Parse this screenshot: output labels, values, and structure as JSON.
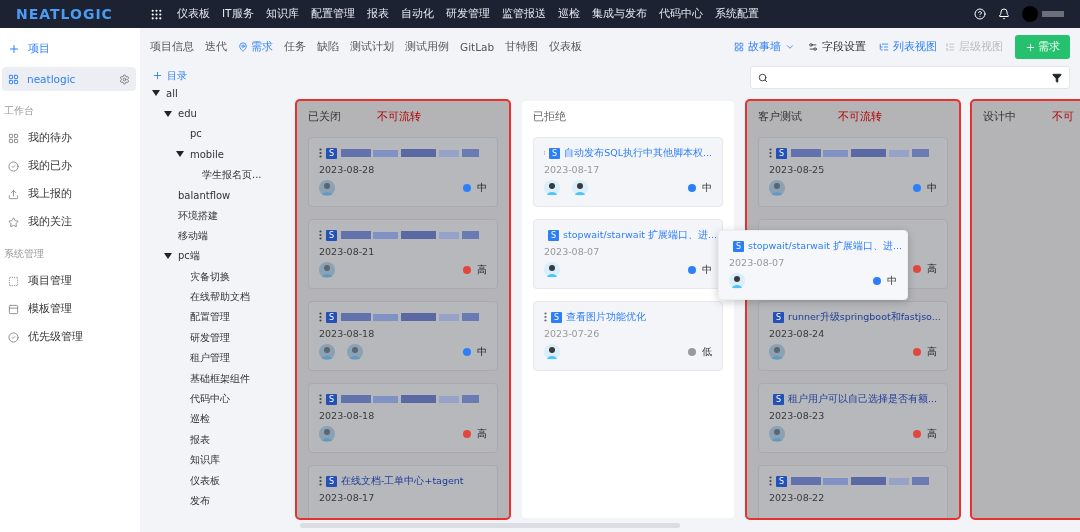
{
  "topbar": {
    "logo": "NEATLOGIC",
    "menu": [
      "仪表板",
      "IT服务",
      "知识库",
      "配置管理",
      "报表",
      "自动化",
      "研发管理",
      "监管报送",
      "巡检",
      "集成与发布",
      "代码中心",
      "系统配置"
    ]
  },
  "sidebar": {
    "add_label": "项目",
    "project": {
      "label": "neatlogic",
      "selected": true
    },
    "groups": [
      {
        "title": "工作台",
        "items": [
          {
            "label": "我的待办"
          },
          {
            "label": "我的已办"
          },
          {
            "label": "我上报的"
          },
          {
            "label": "我的关注"
          }
        ]
      },
      {
        "title": "系统管理",
        "items": [
          {
            "label": "项目管理"
          },
          {
            "label": "模板管理"
          },
          {
            "label": "优先级管理"
          }
        ]
      }
    ]
  },
  "tabs": [
    {
      "label": "项目信息",
      "selected": false
    },
    {
      "label": "迭代",
      "selected": false
    },
    {
      "label": "需求",
      "selected": true
    },
    {
      "label": "任务",
      "selected": false
    },
    {
      "label": "缺陷",
      "selected": false
    },
    {
      "label": "测试计划",
      "selected": false
    },
    {
      "label": "测试用例",
      "selected": false
    },
    {
      "label": "GitLab",
      "selected": false
    },
    {
      "label": "甘特图",
      "selected": false
    },
    {
      "label": "仪表板",
      "selected": false
    }
  ],
  "toolbar": {
    "view_menu": "故事墙",
    "field_settings": "字段设置",
    "list_view": {
      "label": "列表视图",
      "disabled": false
    },
    "tree_view": {
      "label": "层级视图",
      "disabled": true
    },
    "add_button": "需求"
  },
  "tree": {
    "add_label": "目录",
    "nodes": [
      {
        "label": "all",
        "expanded": true,
        "children": [
          {
            "label": "edu",
            "expanded": true,
            "children": [
              {
                "label": "pc"
              },
              {
                "label": "mobile",
                "expanded": true,
                "children": [
                  {
                    "label": "学生报名页..."
                  }
                ]
              }
            ]
          },
          {
            "label": "balantflow"
          },
          {
            "label": "环境搭建"
          },
          {
            "label": "移动端"
          },
          {
            "label": "pc端",
            "expanded": true,
            "children": [
              {
                "label": "灾备切换"
              },
              {
                "label": "在线帮助文档"
              },
              {
                "label": "配置管理"
              },
              {
                "label": "研发管理"
              },
              {
                "label": "租户管理"
              },
              {
                "label": "基础框架组件"
              },
              {
                "label": "代码中心"
              },
              {
                "label": "巡检"
              },
              {
                "label": "报表"
              },
              {
                "label": "知识库"
              },
              {
                "label": "仪表板"
              },
              {
                "label": "发布"
              }
            ]
          }
        ]
      }
    ]
  },
  "columns": [
    {
      "title": "已关闭",
      "disabled": true,
      "note": "不可流转",
      "cards": [
        {
          "type_badge": "S",
          "kind": "blurred",
          "date": "2023-08-28",
          "assignees": [
            {
              "kind": "avatar"
            }
          ],
          "priority": {
            "label": "中",
            "color": "#2d7ff9"
          }
        },
        {
          "type_badge": "S",
          "kind": "blurred",
          "date": "2023-08-21",
          "assignees": [
            {
              "kind": "avatar"
            }
          ],
          "priority": {
            "label": "高",
            "color": "#e0483e"
          }
        },
        {
          "type_badge": "S",
          "kind": "blurred",
          "date": "2023-08-18",
          "assignees": [
            {
              "kind": "avatar"
            },
            {
              "kind": "avatar"
            }
          ],
          "priority": {
            "label": "中",
            "color": "#2d7ff9"
          }
        },
        {
          "type_badge": "S",
          "kind": "blurred",
          "date": "2023-08-18",
          "assignees": [
            {
              "kind": "avatar"
            }
          ],
          "priority": {
            "label": "高",
            "color": "#e0483e"
          }
        },
        {
          "type_badge": "S",
          "kind": "titled",
          "title": "在线文档-工单中心+tagent",
          "date": "2023-08-17"
        }
      ]
    },
    {
      "title": "已拒绝",
      "disabled": false,
      "cards": [
        {
          "type_badge": "S",
          "kind": "titled",
          "title": "自动发布SQL执行中其他脚本权...",
          "date": "2023-08-17",
          "assignees": [
            {
              "kind": "avatar"
            },
            {
              "kind": "avatar"
            }
          ],
          "priority": {
            "label": "中",
            "color": "#2d7ff9"
          }
        },
        {
          "type_badge": "S",
          "kind": "titled",
          "title": "stopwait/starwait 扩展端口、进...",
          "date": "2023-08-07",
          "assignees": [
            {
              "kind": "avatar"
            }
          ],
          "priority": {
            "label": "中",
            "color": "#2d7ff9"
          }
        },
        {
          "type_badge": "S",
          "kind": "titled",
          "title": "查看图片功能优化",
          "date": "2023-07-26",
          "assignees": [
            {
              "kind": "avatar"
            }
          ],
          "priority": {
            "label": "低",
            "color": "#9a9a9a"
          }
        }
      ]
    },
    {
      "title": "客户测试",
      "disabled": true,
      "note": "不可流转",
      "cards": [
        {
          "type_badge": "S",
          "kind": "blurred",
          "date": "2023-08-25",
          "assignees": [
            {
              "kind": "avatar"
            }
          ],
          "priority": {
            "label": "中",
            "color": "#2d7ff9"
          }
        },
        {
          "kind": "covered",
          "priority": {
            "label": "高",
            "color": "#e0483e"
          }
        },
        {
          "type_badge": "S",
          "kind": "titled",
          "title": "runner升级springboot和fastjso...",
          "date": "2023-08-24",
          "assignees": [
            {
              "kind": "avatar"
            }
          ],
          "priority": {
            "label": "高",
            "color": "#e0483e"
          }
        },
        {
          "type_badge": "S",
          "kind": "titled",
          "title": "租户用户可以自己选择是否有额...",
          "date": "2023-08-23",
          "assignees": [
            {
              "kind": "avatar"
            }
          ],
          "priority": {
            "label": "高",
            "color": "#e0483e"
          }
        },
        {
          "type_badge": "S",
          "kind": "blurred",
          "date": "2023-08-22"
        }
      ]
    },
    {
      "title": "设计中",
      "disabled": true,
      "note": "不可"
    }
  ],
  "dragged_card": {
    "type_badge": "S",
    "kind": "titled",
    "title": "stopwait/starwait 扩展端口、进...",
    "date": "2023-08-07",
    "assignees": [
      {
        "kind": "avatar"
      }
    ],
    "priority": {
      "label": "中",
      "color": "#2d7ff9"
    }
  }
}
